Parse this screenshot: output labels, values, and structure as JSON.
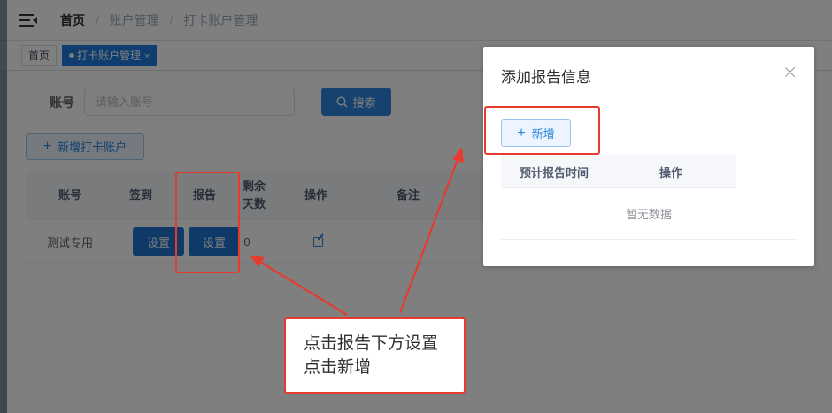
{
  "breadcrumb": {
    "home": "首页",
    "sep": "/",
    "level1": "账户管理",
    "level2": "打卡账户管理"
  },
  "tags": {
    "home": "首页",
    "active": "打卡账户管理",
    "close": "×"
  },
  "search": {
    "label": "账号",
    "placeholder": "请输入账号",
    "button": "搜索",
    "search_icon": "search-icon"
  },
  "add_account_button": "新增打卡账户",
  "table": {
    "headers": {
      "account": "账号",
      "checkin": "签到",
      "report": "报告",
      "remaining": "剩余天数",
      "remaining_line1": "剩余",
      "remaining_line2": "天数",
      "action": "操作",
      "remark": "备注"
    },
    "rows": [
      {
        "account": "测试专用",
        "checkin_button": "设置",
        "report_button": "设置",
        "remaining": "0",
        "action_icon": "edit-icon"
      }
    ]
  },
  "dialog": {
    "title": "添加报告信息",
    "new_button": "新增",
    "headers": {
      "time": "预计报告时间",
      "action": "操作"
    },
    "empty_text": "暂无数据"
  },
  "annotation": {
    "line1": "点击报告下方设置",
    "line2": "点击新增"
  },
  "colors": {
    "primary": "#2b84dc",
    "annotation_red": "#e63b2e"
  }
}
